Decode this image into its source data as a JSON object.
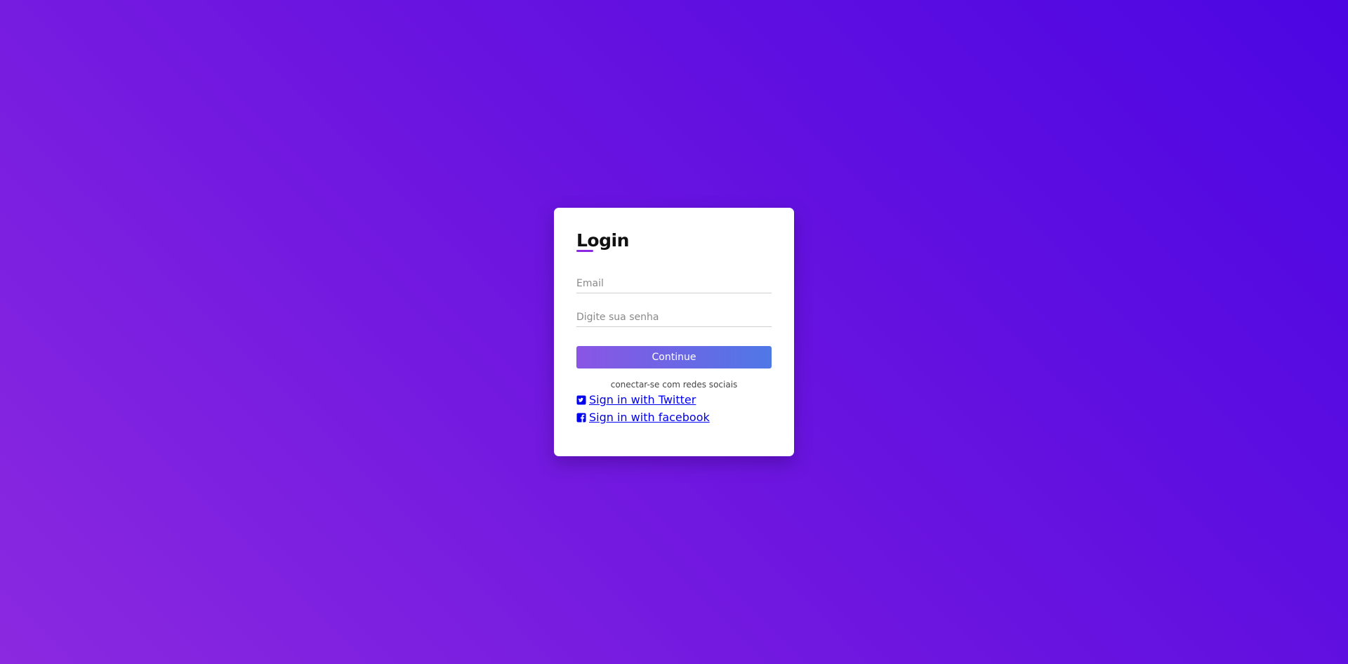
{
  "login": {
    "title": "Login",
    "email_placeholder": "Email",
    "password_placeholder": "Digite sua senha",
    "continue_label": "Continue",
    "social_caption": "conectar-se com redes sociais",
    "social": [
      {
        "icon": "twitter-square-icon",
        "label": " Sign in with Twitter"
      },
      {
        "icon": "facebook-square-icon",
        "label": " Sign in with facebook"
      }
    ]
  },
  "colors": {
    "background_start": "#8b29e0",
    "background_end": "#4c06e2",
    "accent": "#8b29e0",
    "button_start": "#8a55e4",
    "button_end": "#4f78e6",
    "link": "#0000ee"
  }
}
